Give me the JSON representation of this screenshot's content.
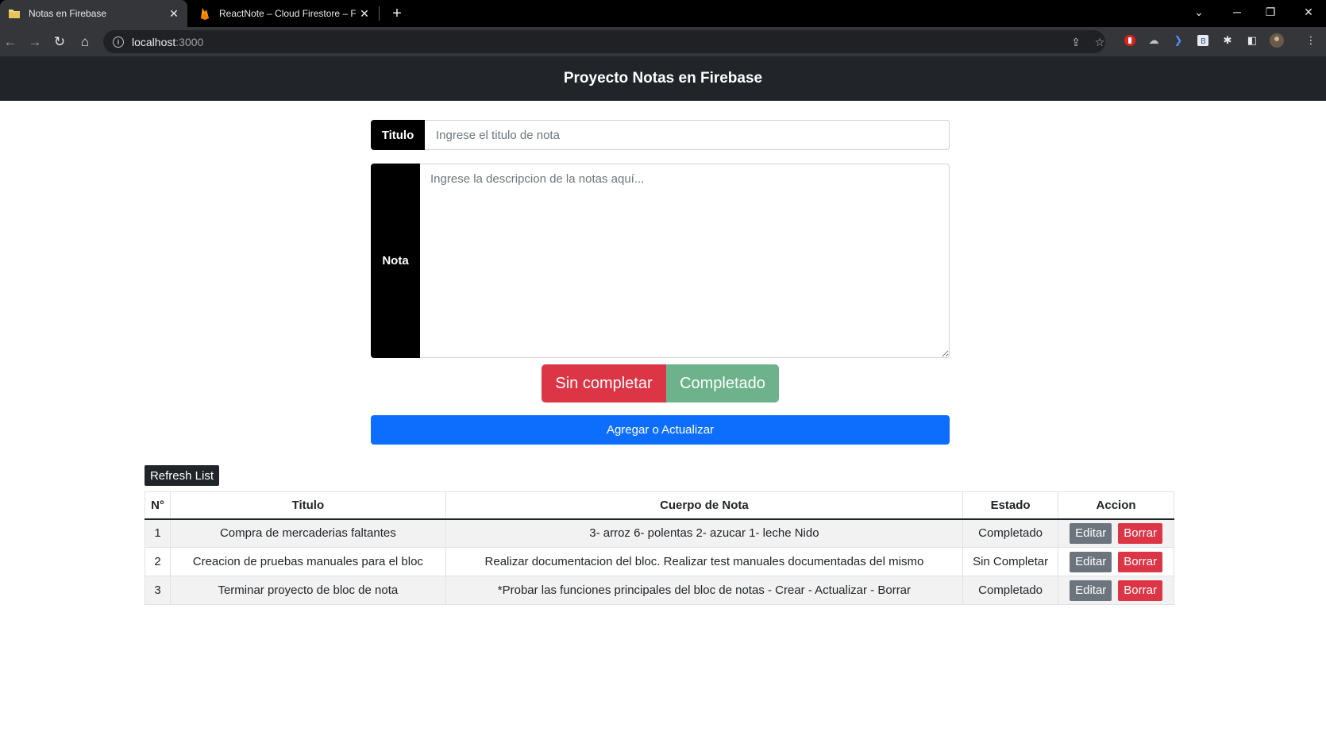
{
  "browser": {
    "tabs": [
      {
        "title": "Notas en Firebase",
        "icon": "folder-favicon-icon",
        "active": true
      },
      {
        "title": "ReactNote – Cloud Firestore – Fi",
        "icon": "firebase-favicon-icon",
        "active": false
      }
    ],
    "url_host": "localhost",
    "url_port": ":3000"
  },
  "app": {
    "header_title": "Proyecto Notas en Firebase",
    "form": {
      "title_label": "Titulo",
      "title_placeholder": "Ingrese el titulo de nota",
      "title_value": "",
      "note_label": "Nota",
      "note_placeholder": "Ingrese la descripcion de la notas aquí...",
      "note_value": "",
      "status_incomplete_label": "Sin completar",
      "status_complete_label": "Completado",
      "submit_label": "Agregar o Actualizar"
    },
    "refresh_label": "Refresh List",
    "table": {
      "headers": [
        "N°",
        "Titulo",
        "Cuerpo de Nota",
        "Estado",
        "Accion"
      ],
      "edit_label": "Editar",
      "delete_label": "Borrar",
      "rows": [
        {
          "num": "1",
          "title": "Compra de mercaderias faltantes",
          "body": "3- arroz 6- polentas 2- azucar 1- leche Nido",
          "status": "Completado"
        },
        {
          "num": "2",
          "title": "Creacion de pruebas manuales para el bloc",
          "body": "Realizar documentacion del bloc. Realizar test manuales documentadas del mismo",
          "status": "Sin Completar"
        },
        {
          "num": "3",
          "title": "Terminar proyecto de bloc de nota",
          "body": "*Probar las funciones principales del bloc de notas - Crear - Actualizar - Borrar",
          "status": "Completado"
        }
      ]
    }
  },
  "colors": {
    "header_bg": "#212529",
    "incomplete": "#dc3545",
    "complete": "#6cb28a",
    "primary": "#0d6efd",
    "edit": "#6c757d"
  }
}
